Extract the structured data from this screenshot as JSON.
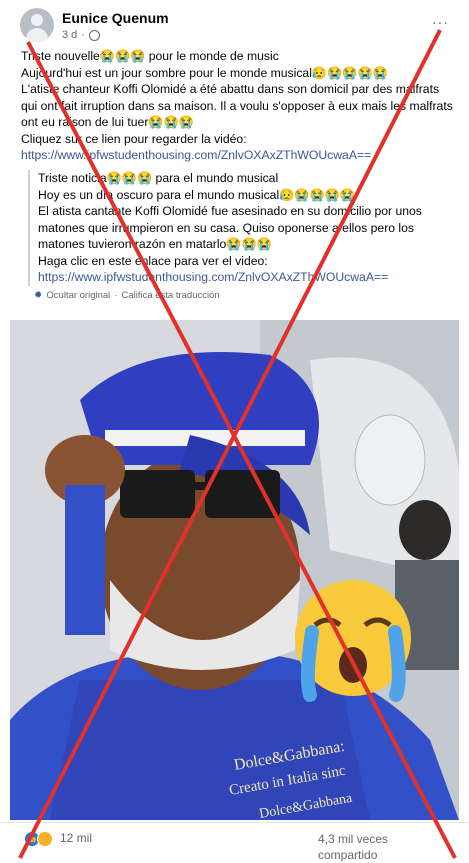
{
  "post": {
    "author": "Eunice Quenum",
    "time": "3 d",
    "more": "···",
    "lines": [
      "Triste nouvelle😭😭😭 pour le monde de music",
      "Aujourd'hui est un jour sombre pour le monde musical😥😭😭😭😭",
      "L'atiste chanteur Koffi Olomidé a été abattu dans son domicil par des malfrats",
      "qui ont fait irruption dans sa maison. Il a voulu s'opposer à eux mais les malfrats",
      "ont eu raison de lui tuer😭😭😭",
      "Cliquez sur ce lien pour regarder la vidéo:"
    ],
    "link": "https://www.ipfwstudenthousing.com/ZnlvOXAxZThWOUcwaA=="
  },
  "translation": {
    "lines": [
      "Triste noticia😭😭😭 para el mundo musical",
      "Hoy es un día oscuro para el mundo musical😥😭😭😭😭",
      "El atista cantante Koffi Olomidé fue asesinado en su domicilio por unos",
      "matones que irrumpieron en su casa. Quiso oponerse a ellos pero los",
      "matones tuvieron razón en matarlo😭😭😭",
      "Haga clic en este enlace para ver el video:"
    ],
    "link": "https://www.ipfwstudenthousing.com/ZnlvOXAxZThWOUcwaA==",
    "hide_original": "Ocultar original",
    "separator": "·",
    "rate": "Califica esta traducción"
  },
  "photo": {
    "shirt_text": [
      "Dolce&Gabbana:",
      "Creato in Italia sinc",
      "Dolce&Gabbana"
    ]
  },
  "footer": {
    "reaction_count": "12 mil",
    "shares_line1": "4,3 mil veces",
    "shares_line2": "compartido"
  },
  "colors": {
    "link": "#385898",
    "x_mark": "#e0312a",
    "secondary_text": "#65676b",
    "cap_blue": "#2f3fbf",
    "shirt_blue": "#3250c8"
  },
  "icons": {
    "globe": "globe-icon",
    "gear": "gear-icon",
    "like": "like-reaction-icon",
    "sad": "sad-reaction-icon",
    "crying": "crying-emoji-sticker"
  }
}
